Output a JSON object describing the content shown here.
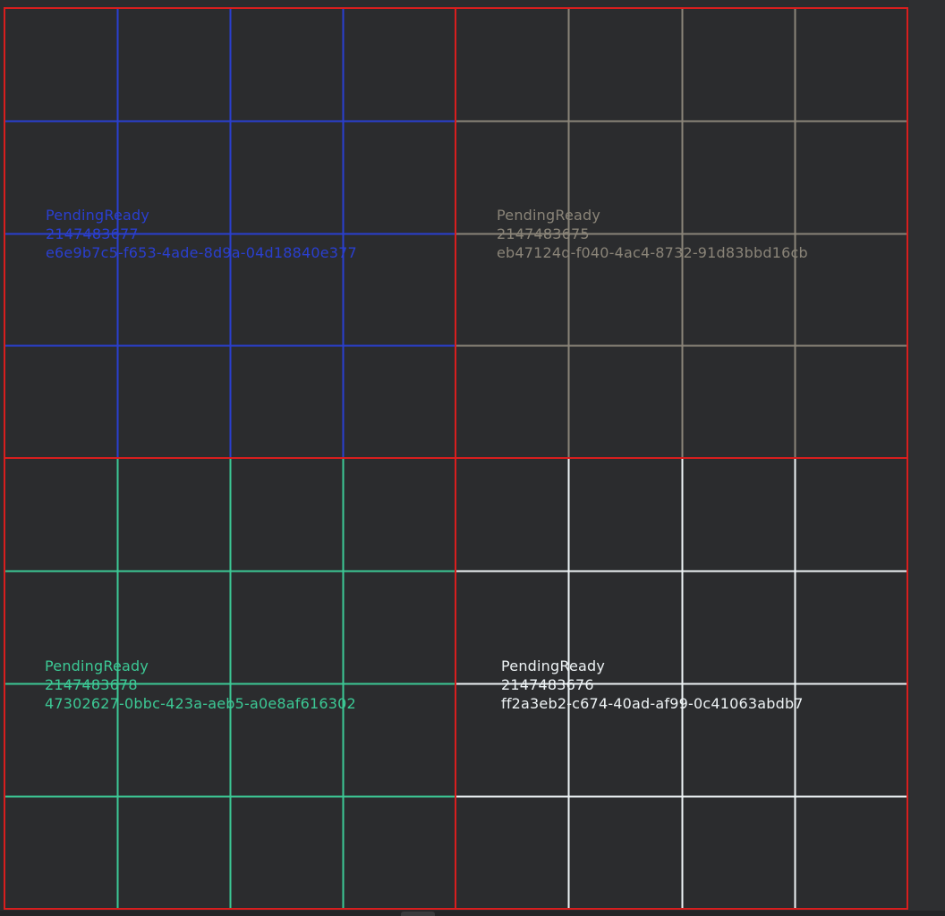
{
  "tiles": [
    {
      "status": "PendingReady",
      "number": "2147483677",
      "uuid": "e6e9b7c5-f653-4ade-8d9a-04d18840e377",
      "color": "#2a3fd0"
    },
    {
      "status": "PendingReady",
      "number": "2147483675",
      "uuid": "eb47124d-f040-4ac4-8732-91d83bbd16cb",
      "color": "#8a8478"
    },
    {
      "status": "PendingReady",
      "number": "2147483678",
      "uuid": "47302627-0bbc-423a-aeb5-a0e8af616302",
      "color": "#3cc995"
    },
    {
      "status": "PendingReady",
      "number": "2147483676",
      "uuid": "ff2a3eb2-c674-40ad-af99-0c41063abdb7",
      "color": "#eef3f5"
    }
  ],
  "border_color": "#d81e1e"
}
